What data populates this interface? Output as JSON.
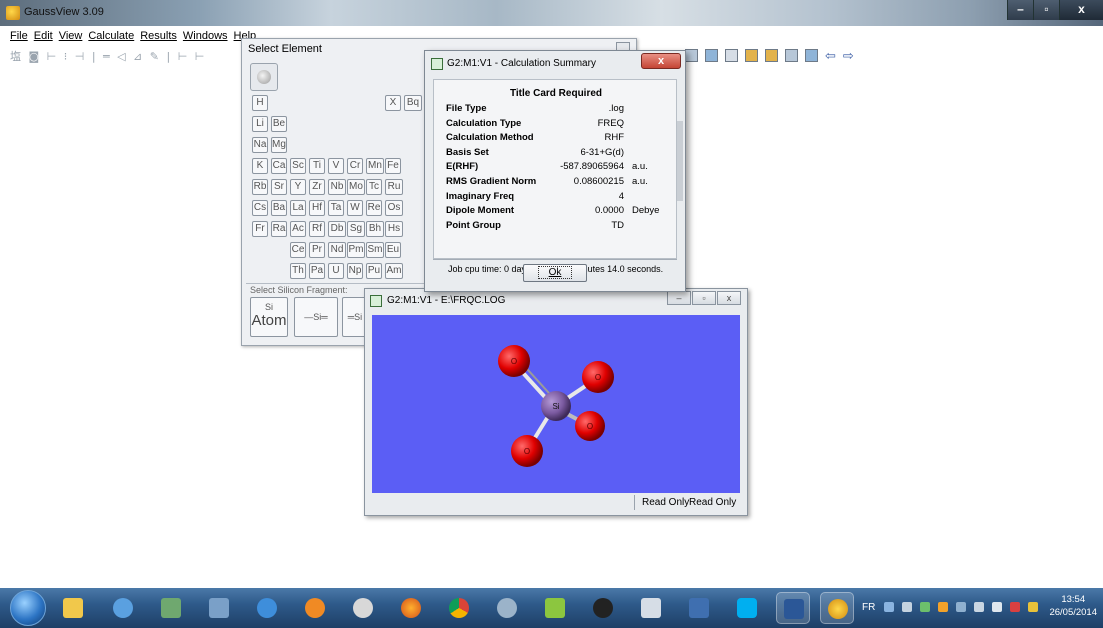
{
  "app": {
    "title": "GaussView 3.09"
  },
  "menu": [
    "File",
    "Edit",
    "View",
    "Calculate",
    "Results",
    "Windows",
    "Help"
  ],
  "toolbar_left_text": "塩 ◙ ⊢ ⁝ ⊣ | ═ ◁ ⊿ ✎ | ⊢ ⊢",
  "select_element": {
    "title": "Select Element",
    "elements": [
      {
        "row": 0,
        "col": 0,
        "s": "H"
      },
      {
        "row": 0,
        "col": 7,
        "s": "X"
      },
      {
        "row": 0,
        "col": 8,
        "s": "Bq"
      },
      {
        "row": 1,
        "col": 0,
        "s": "Li"
      },
      {
        "row": 1,
        "col": 1,
        "s": "Be"
      },
      {
        "row": 2,
        "col": 0,
        "s": "Na"
      },
      {
        "row": 2,
        "col": 1,
        "s": "Mg"
      },
      {
        "row": 3,
        "col": 0,
        "s": "K"
      },
      {
        "row": 3,
        "col": 1,
        "s": "Ca"
      },
      {
        "row": 3,
        "col": 2,
        "s": "Sc"
      },
      {
        "row": 3,
        "col": 3,
        "s": "Ti"
      },
      {
        "row": 3,
        "col": 4,
        "s": "V"
      },
      {
        "row": 3,
        "col": 5,
        "s": "Cr"
      },
      {
        "row": 3,
        "col": 6,
        "s": "Mn"
      },
      {
        "row": 3,
        "col": 7,
        "s": "Fe"
      },
      {
        "row": 4,
        "col": 0,
        "s": "Rb"
      },
      {
        "row": 4,
        "col": 1,
        "s": "Sr"
      },
      {
        "row": 4,
        "col": 2,
        "s": "Y"
      },
      {
        "row": 4,
        "col": 3,
        "s": "Zr"
      },
      {
        "row": 4,
        "col": 4,
        "s": "Nb"
      },
      {
        "row": 4,
        "col": 5,
        "s": "Mo"
      },
      {
        "row": 4,
        "col": 6,
        "s": "Tc"
      },
      {
        "row": 4,
        "col": 7,
        "s": "Ru"
      },
      {
        "row": 5,
        "col": 0,
        "s": "Cs"
      },
      {
        "row": 5,
        "col": 1,
        "s": "Ba"
      },
      {
        "row": 5,
        "col": 2,
        "s": "La"
      },
      {
        "row": 5,
        "col": 3,
        "s": "Hf"
      },
      {
        "row": 5,
        "col": 4,
        "s": "Ta"
      },
      {
        "row": 5,
        "col": 5,
        "s": "W"
      },
      {
        "row": 5,
        "col": 6,
        "s": "Re"
      },
      {
        "row": 5,
        "col": 7,
        "s": "Os"
      },
      {
        "row": 6,
        "col": 0,
        "s": "Fr"
      },
      {
        "row": 6,
        "col": 1,
        "s": "Ra"
      },
      {
        "row": 6,
        "col": 2,
        "s": "Ac"
      },
      {
        "row": 6,
        "col": 3,
        "s": "Rf"
      },
      {
        "row": 6,
        "col": 4,
        "s": "Db"
      },
      {
        "row": 6,
        "col": 5,
        "s": "Sg"
      },
      {
        "row": 6,
        "col": 6,
        "s": "Bh"
      },
      {
        "row": 6,
        "col": 7,
        "s": "Hs"
      },
      {
        "row": 7,
        "col": 2,
        "s": "Ce"
      },
      {
        "row": 7,
        "col": 3,
        "s": "Pr"
      },
      {
        "row": 7,
        "col": 4,
        "s": "Nd"
      },
      {
        "row": 7,
        "col": 5,
        "s": "Pm"
      },
      {
        "row": 7,
        "col": 6,
        "s": "Sm"
      },
      {
        "row": 7,
        "col": 7,
        "s": "Eu"
      },
      {
        "row": 8,
        "col": 2,
        "s": "Th"
      },
      {
        "row": 8,
        "col": 3,
        "s": "Pa"
      },
      {
        "row": 8,
        "col": 4,
        "s": "U"
      },
      {
        "row": 8,
        "col": 5,
        "s": "Np"
      },
      {
        "row": 8,
        "col": 6,
        "s": "Pu"
      },
      {
        "row": 8,
        "col": 7,
        "s": "Am"
      }
    ],
    "fragment_label": "Select Silicon Fragment:",
    "fragments": [
      {
        "top": "Si",
        "bottom": "Atom"
      },
      {
        "top": "—Si═",
        "bottom": ""
      },
      {
        "top": "═Si",
        "bottom": ""
      }
    ]
  },
  "calc_summary": {
    "title": "G2:M1:V1 - Calculation Summary",
    "close": "x",
    "heading": "Title Card Required",
    "rows": [
      {
        "label": "File Type",
        "value": ".log",
        "unit": ""
      },
      {
        "label": "Calculation Type",
        "value": "FREQ",
        "unit": ""
      },
      {
        "label": "Calculation Method",
        "value": "RHF",
        "unit": ""
      },
      {
        "label": "Basis Set",
        "value": "6-31+G(d)",
        "unit": ""
      },
      {
        "label": "E(RHF)",
        "value": "-587.89065964",
        "unit": "a.u."
      },
      {
        "label": "RMS Gradient Norm",
        "value": "0.08600215",
        "unit": "a.u."
      },
      {
        "label": "Imaginary Freq",
        "value": "4",
        "unit": ""
      },
      {
        "label": "Dipole Moment",
        "value": "0.0000",
        "unit": "Debye"
      },
      {
        "label": "Point Group",
        "value": "TD",
        "unit": ""
      }
    ],
    "cpu_time": "Job cpu time:  0 days  0 hours  1 minutes 14.0 seconds.",
    "ok_label": "Ok"
  },
  "molecule_window": {
    "title": "G2:M1:V1 - E:\\FRQC.LOG",
    "status": [
      "Read Only",
      "Read Only"
    ],
    "atoms": [
      {
        "label": "Si",
        "color": "#7b5aa0"
      },
      {
        "label": "O",
        "color": "#e00000"
      },
      {
        "label": "O",
        "color": "#e00000"
      },
      {
        "label": "O",
        "color": "#e00000"
      },
      {
        "label": "O",
        "color": "#e00000"
      }
    ]
  },
  "taskbar": {
    "language": "FR",
    "time": "13:54",
    "date": "26/05/2014"
  }
}
